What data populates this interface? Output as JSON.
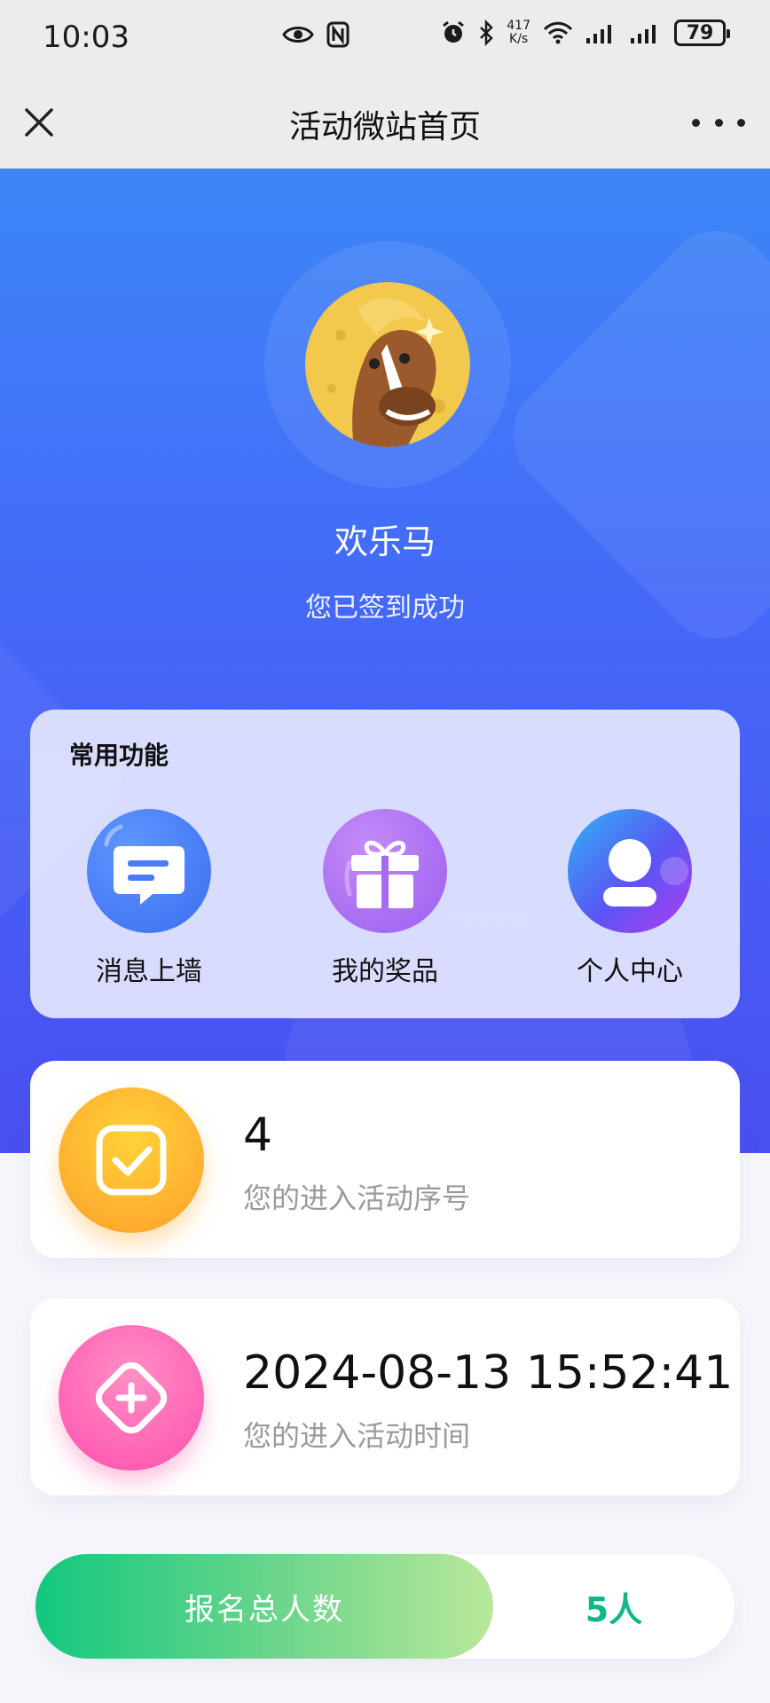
{
  "status_bar": {
    "time": "10:03",
    "net_speed_value": "417",
    "net_speed_unit": "K/s",
    "battery": "79"
  },
  "nav": {
    "title": "活动微站首页",
    "close_icon": "close-icon",
    "more_icon": "more-dots-icon"
  },
  "profile": {
    "name": "欢乐马",
    "status": "您已签到成功"
  },
  "features": {
    "title": "常用功能",
    "items": [
      {
        "label": "消息上墙",
        "icon": "message-icon",
        "color": "#4a7cf5"
      },
      {
        "label": "我的奖品",
        "icon": "gift-icon",
        "color": "#a66af0"
      },
      {
        "label": "个人中心",
        "icon": "user-icon",
        "color": "#6a4cf5"
      }
    ]
  },
  "entry_number": {
    "value": "4",
    "label": "您的进入活动序号",
    "icon": "checkbox-icon",
    "color": "#ffb12c"
  },
  "entry_time": {
    "value": "2024-08-13 15:52:41",
    "label": "您的进入活动时间",
    "icon": "plus-diamond-icon",
    "color": "#ff5fb0"
  },
  "total": {
    "label": "报名总人数",
    "value": "5人",
    "accent": "#13b58a"
  }
}
